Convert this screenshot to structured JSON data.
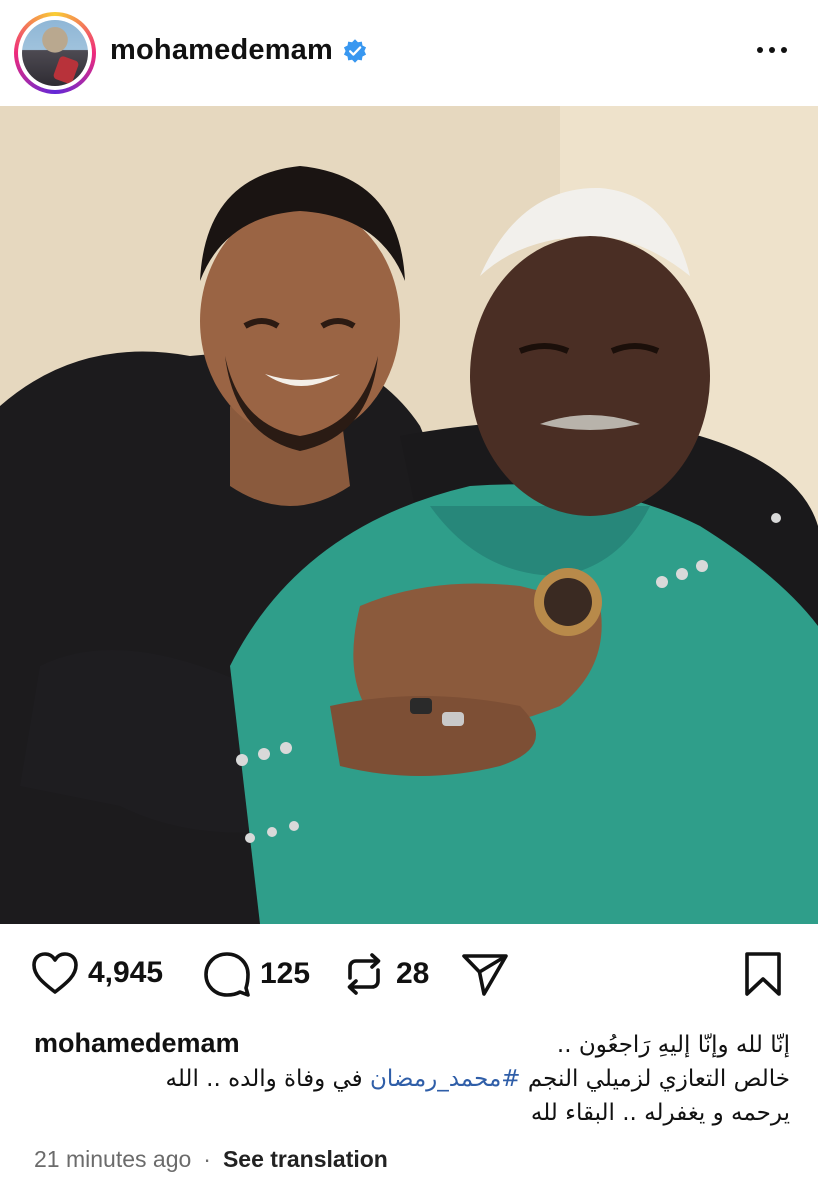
{
  "header": {
    "username": "mohamedemam",
    "verified_icon": "verified-badge-icon",
    "more_icon": "more-horizontal-icon"
  },
  "photo": {
    "alt_icon": "post-photo"
  },
  "actions": {
    "likes": "4,945",
    "comments": "125",
    "reposts": "28",
    "colors": {
      "icon": "#111111"
    }
  },
  "caption": {
    "username": "mohamedemam",
    "line1": "إنّا لله وإنّا إليهِ رَاجعُون ..",
    "line2_before": "خالص التعازي لزميلي النجم ",
    "hashtag": "#محمد_رمضان",
    "line2_after": " في وفاة والده .. الله",
    "line3": "يرحمه و يغفرله .. البقاء لله",
    "hashtag_color": "#2f5ea8"
  },
  "footer": {
    "time": "21 minutes ago",
    "separator": "·",
    "see_translation": "See translation"
  }
}
